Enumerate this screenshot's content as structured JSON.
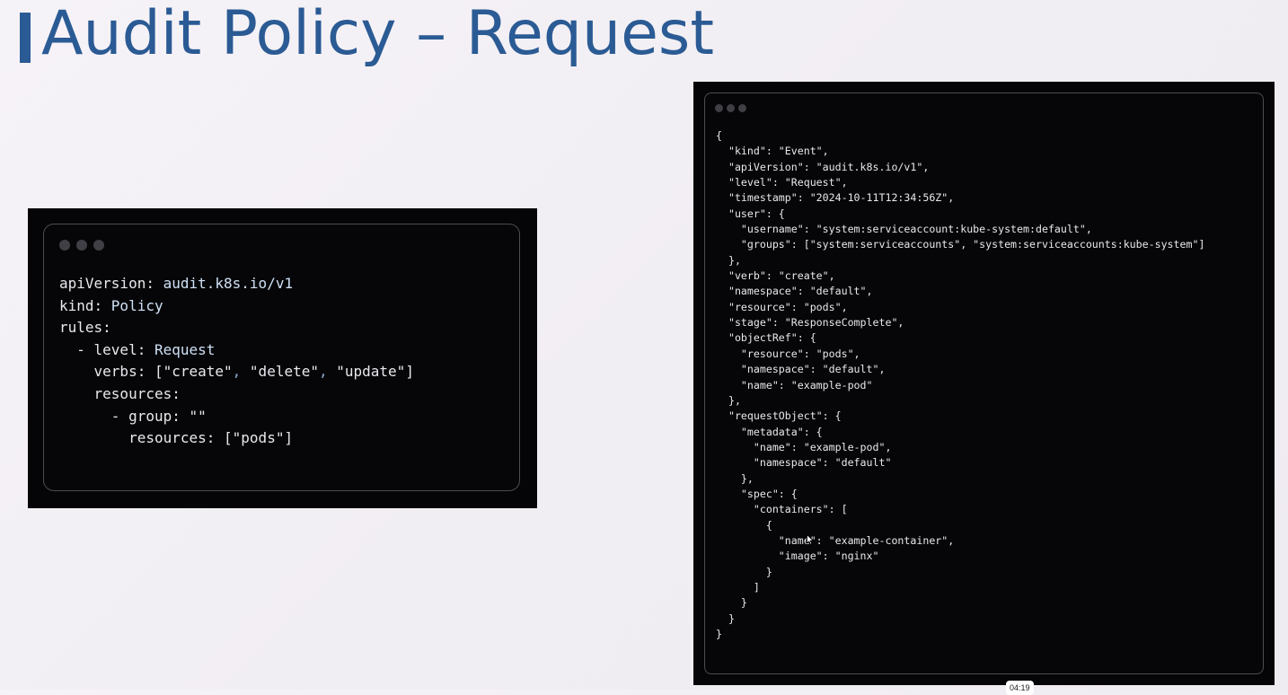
{
  "title": "Audit Policy – Request",
  "policy_yaml": {
    "lines": [
      "apiVersion: audit.k8s.io/v1",
      "kind: Policy",
      "rules:",
      "  - level: Request",
      "    verbs: [\"create\", \"delete\", \"update\"]",
      "    resources:",
      "      - group: \"\"",
      "        resources: [\"pods\"]"
    ]
  },
  "event_json": {
    "lines": [
      "{",
      "  \"kind\": \"Event\",",
      "  \"apiVersion\": \"audit.k8s.io/v1\",",
      "  \"level\": \"Request\",",
      "  \"timestamp\": \"2024-10-11T12:34:56Z\",",
      "  \"user\": {",
      "    \"username\": \"system:serviceaccount:kube-system:default\",",
      "    \"groups\": [\"system:serviceaccounts\", \"system:serviceaccounts:kube-system\"]",
      "  },",
      "  \"verb\": \"create\",",
      "  \"namespace\": \"default\",",
      "  \"resource\": \"pods\",",
      "  \"stage\": \"ResponseComplete\",",
      "  \"objectRef\": {",
      "    \"resource\": \"pods\",",
      "    \"namespace\": \"default\",",
      "    \"name\": \"example-pod\"",
      "  },",
      "  \"requestObject\": {",
      "    \"metadata\": {",
      "      \"name\": \"example-pod\",",
      "      \"namespace\": \"default\"",
      "    },",
      "    \"spec\": {",
      "      \"containers\": [",
      "        {",
      "          \"name\": \"example-container\",",
      "          \"image\": \"nginx\"",
      "        }",
      "      ]",
      "    }",
      "  }",
      "}"
    ]
  },
  "video_time": "04:19",
  "colors": {
    "accent": "#2b5b94",
    "window_bg": "#060608",
    "window_dot": "#3f3f45",
    "code_text": "#e8e8ee"
  }
}
